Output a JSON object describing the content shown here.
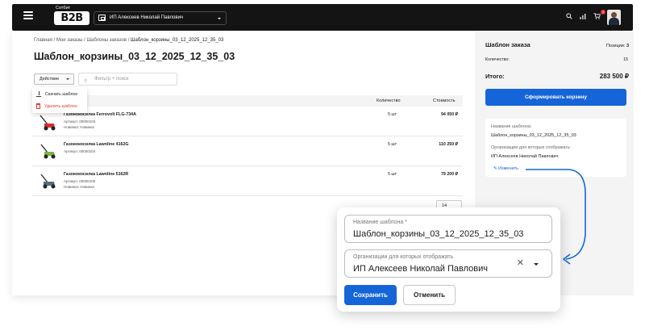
{
  "header": {
    "logo_small": "Сотбит",
    "logo_text": "B2B",
    "org_selected": "ИП Алексеев Николай Павлович",
    "cart_count": "1"
  },
  "breadcrumb": {
    "items": [
      "Главная",
      "Мои заказы",
      "Шаблоны заказов"
    ],
    "current": "Шаблон_корзины_03_12_2025_12_35_03",
    "separator": "/"
  },
  "page_title": "Шаблон_корзины_03_12_2025_12_35_03",
  "toolbar": {
    "action_label": "Действие",
    "filter_placeholder": "Фильтр + поиск"
  },
  "action_menu": {
    "download": "Скачать шаблон",
    "delete": "Удалить шаблон"
  },
  "table": {
    "columns": {
      "quantity": "Количество",
      "cost": "Стоимость"
    },
    "rows": [
      {
        "name": "Газонокосилка Ferrovolt FLG-734A",
        "article": "Артикул: 00000103",
        "badge": "Новинка: Новинка",
        "qty": "5 шт",
        "price": "94 050 ₽"
      },
      {
        "name": "Газонокосилка Lawnline 4162G",
        "article": "Артикул: 00000104",
        "badge": "",
        "qty": "5 шт",
        "price": "110 250 ₽"
      },
      {
        "name": "Газонокосилка Lawnline 5162R",
        "article": "Артикул: 00000105",
        "badge": "Новинка: Новинка",
        "qty": "5 шт",
        "price": "79 200 ₽"
      }
    ],
    "page_size": "14"
  },
  "summary": {
    "title": "Шаблон заказа",
    "positions_label": "Позиции:",
    "positions_value": "3",
    "quantity_label": "Количество:",
    "quantity_value": "15",
    "total_label": "Итого:",
    "total_value": "283 500 ₽",
    "form_cart_button": "Сформировать корзину"
  },
  "template_info": {
    "name_label": "Название шаблона:",
    "name_value": "Шаблон_корзины_03_12_2025_12_35_03",
    "orgs_label": "Организации для которых отображать:",
    "orgs_value": "ИП Алексеев Николай Павлович",
    "edit_link": "Изменить"
  },
  "edit_modal": {
    "name_label": "Название шаблона *",
    "name_value": "Шаблон_корзины_03_12_2025_12_35_03",
    "orgs_label": "Организации для которых отображать",
    "orgs_value": "ИП Алексеев Николай Павлович",
    "save_button": "Сохранить",
    "cancel_button": "Отменить"
  },
  "colors": {
    "accent": "#1565d8",
    "topbar": "#141414",
    "danger": "#e53935",
    "sidebar_bg": "#f4f4f5"
  }
}
